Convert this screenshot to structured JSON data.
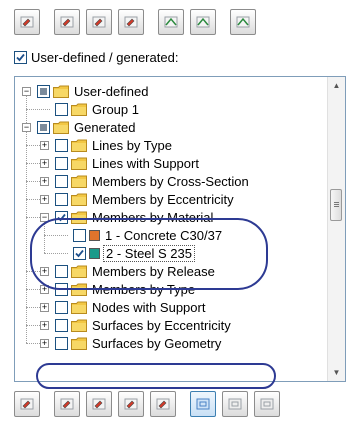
{
  "top_toolbar": {
    "buttons": [
      {
        "name": "select-all-icon",
        "group": "gap"
      },
      {
        "name": "select-icon",
        "group": ""
      },
      {
        "name": "deselect-icon",
        "group": ""
      },
      {
        "name": "invert-selection-icon",
        "group": "gap"
      },
      {
        "name": "filter-icon",
        "group": ""
      },
      {
        "name": "filter-remove-icon",
        "group": "gap"
      },
      {
        "name": "apply-icon",
        "group": ""
      }
    ]
  },
  "user_defined_checkbox": {
    "label": "User-defined / generated:",
    "checked": true
  },
  "tree": {
    "items": [
      {
        "level": 0,
        "type": "folder",
        "label": "User-defined",
        "state": "partial",
        "expander": "-"
      },
      {
        "level": 1,
        "type": "folder",
        "label": "Group 1",
        "state": "unchecked",
        "expander": ""
      },
      {
        "level": 0,
        "type": "folder",
        "label": "Generated",
        "state": "partial",
        "expander": "-"
      },
      {
        "level": 1,
        "type": "folder",
        "label": "Lines by Type",
        "state": "unchecked",
        "expander": "+"
      },
      {
        "level": 1,
        "type": "folder",
        "label": "Lines with Support",
        "state": "unchecked",
        "expander": "+"
      },
      {
        "level": 1,
        "type": "folder",
        "label": "Members by Cross-Section",
        "state": "unchecked",
        "expander": "+"
      },
      {
        "level": 1,
        "type": "folder",
        "label": "Members by Eccentricity",
        "state": "unchecked",
        "expander": "+"
      },
      {
        "level": 1,
        "type": "folder",
        "label": "Members by Material",
        "state": "checked",
        "expander": "-"
      },
      {
        "level": 2,
        "type": "swatch",
        "label": "1 - Concrete C30/37",
        "state": "unchecked",
        "color": "#e0742c"
      },
      {
        "level": 2,
        "type": "swatch",
        "label": "2 - Steel S 235",
        "state": "checked",
        "color": "#1a9a8a",
        "selected": true
      },
      {
        "level": 1,
        "type": "folder",
        "label": "Members by Release",
        "state": "unchecked",
        "expander": "+"
      },
      {
        "level": 1,
        "type": "folder",
        "label": "Members by Type",
        "state": "unchecked",
        "expander": "+"
      },
      {
        "level": 1,
        "type": "folder",
        "label": "Nodes with Support",
        "state": "unchecked",
        "expander": "+"
      },
      {
        "level": 1,
        "type": "folder",
        "label": "Surfaces by Eccentricity",
        "state": "unchecked",
        "expander": "+"
      },
      {
        "level": 1,
        "type": "folder",
        "label": "Surfaces by Geometry",
        "state": "unchecked",
        "expander": "+"
      }
    ]
  },
  "bottom_toolbar": {
    "buttons": [
      {
        "name": "edit-selection-icon",
        "group": "gap"
      },
      {
        "name": "new-group-icon",
        "group": ""
      },
      {
        "name": "edit-group-icon",
        "group": ""
      },
      {
        "name": "delete-group-icon",
        "group": ""
      },
      {
        "name": "copy-group-icon",
        "group": "gap"
      },
      {
        "name": "show-all-icon",
        "group": "",
        "active": true
      },
      {
        "name": "show-selected-icon",
        "group": ""
      },
      {
        "name": "hide-selected-icon",
        "group": ""
      }
    ]
  },
  "colors": {
    "accent": "#2d3a93",
    "folder": "#f2c744",
    "checkmark": "#1c4f8c"
  }
}
